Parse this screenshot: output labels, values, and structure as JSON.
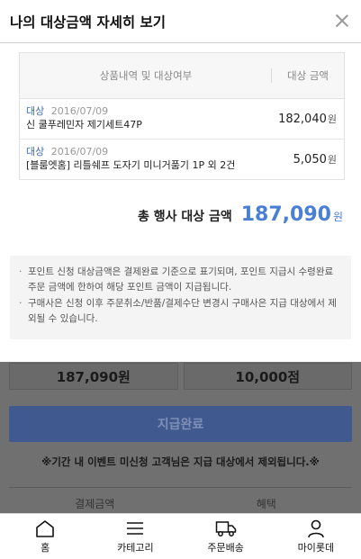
{
  "background": {
    "amount_paid": "187,090원",
    "points": "10,000점",
    "complete_button": "지급완료",
    "notice": "※기간 내 이벤트 미신청 고객님은 지급 대상에서 제외됩니다.※",
    "table_headers": [
      "결제금액",
      "혜택"
    ]
  },
  "modal": {
    "title": "나의 대상금액 자세히 보기",
    "table": {
      "header_item": "상품내역 및 대상여부",
      "header_amount": "대상 금액",
      "rows": [
        {
          "tag": "대상",
          "date": "2016/07/09",
          "name": "신 쿨푸레민자 제기세트47P",
          "amount": "182,040",
          "won": "원"
        },
        {
          "tag": "대상",
          "date": "2016/07/09",
          "name": "[블룸엣홈] 리틀쉐프 도자기 미니거품기 1P 외 2건",
          "amount": "5,050",
          "won": "원"
        }
      ]
    },
    "total": {
      "label": "총 행사 대상 금액",
      "amount": "187,090",
      "won": "원"
    },
    "notes": [
      "포인트 신청 대상금액은 결제완료 기준으로 표기되며, 포인트 지급시 수령완료 주문 금액에 한하여 해당 포인트 금액이 지급됩니다.",
      "구매사은 신청 이후 주문취소/반품/결제수단 변경시 구매사은 지급 대상에서 제외될 수 있습니다."
    ]
  },
  "bottom_nav": [
    {
      "label": "홈",
      "icon": "home-icon"
    },
    {
      "label": "카테고리",
      "icon": "menu-icon"
    },
    {
      "label": "주문배송",
      "icon": "truck-icon"
    },
    {
      "label": "마이롯데",
      "icon": "person-icon"
    }
  ],
  "colors": {
    "accent_blue": "#4a7fd6",
    "tag_blue": "#3f6db5",
    "button_blue": "#405a8f"
  }
}
